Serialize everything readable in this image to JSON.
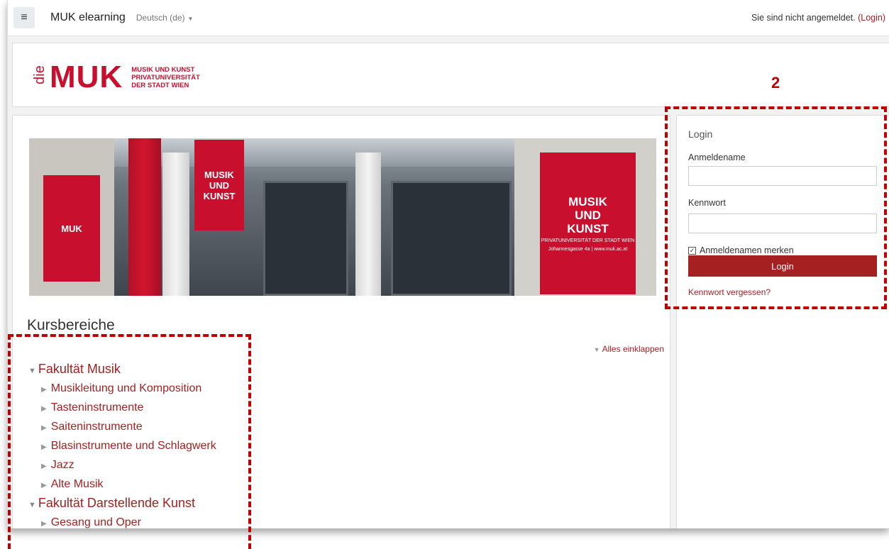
{
  "navbar": {
    "menu_icon": "hamburger-icon",
    "brand": "MUK elearning",
    "language": "Deutsch (de)",
    "login_text": "Sie sind nicht angemeldet.",
    "login_link": "(Login)"
  },
  "header": {
    "logo_die": "die",
    "logo_muk": "MUK",
    "logo_line1": "MUSIK UND KUNST",
    "logo_line2": "PRIVATUNIVERSITÄT",
    "logo_line3": "DER STADT WIEN"
  },
  "banner": {
    "flag_left": [
      "MUSIK",
      "UND",
      "KUNST"
    ],
    "flag_right": [
      "MUSIK",
      "UND",
      "KUNST"
    ],
    "flag_sub": "PRIVATUNIVERSITÄT DER STADT WIEN",
    "address_right": "Johannesgasse 4a | www.muk.ac.at",
    "flag_small_label": "MUK"
  },
  "courses": {
    "title": "Kursbereiche",
    "collapse_all": "Alles einklappen",
    "categories": [
      {
        "label": "Fakultät Musik",
        "subcategories": [
          "Musikleitung und Komposition",
          "Tasteninstrumente",
          "Saiteninstrumente",
          "Blasinstrumente und Schlagwerk",
          "Jazz",
          "Alte Musik"
        ]
      },
      {
        "label": "Fakultät Darstellende Kunst",
        "subcategories": [
          "Gesang und Oper"
        ]
      }
    ]
  },
  "login": {
    "title": "Login",
    "username_label": "Anmeldename",
    "password_label": "Kennwort",
    "remember_label": "Anmeldenamen merken",
    "remember_checked": true,
    "button": "Login",
    "forgot": "Kennwort vergessen?"
  },
  "annotation": {
    "number": "2",
    "color": "#c00000"
  },
  "colors": {
    "brand_red": "#c8102e",
    "link_red": "#a52121"
  }
}
